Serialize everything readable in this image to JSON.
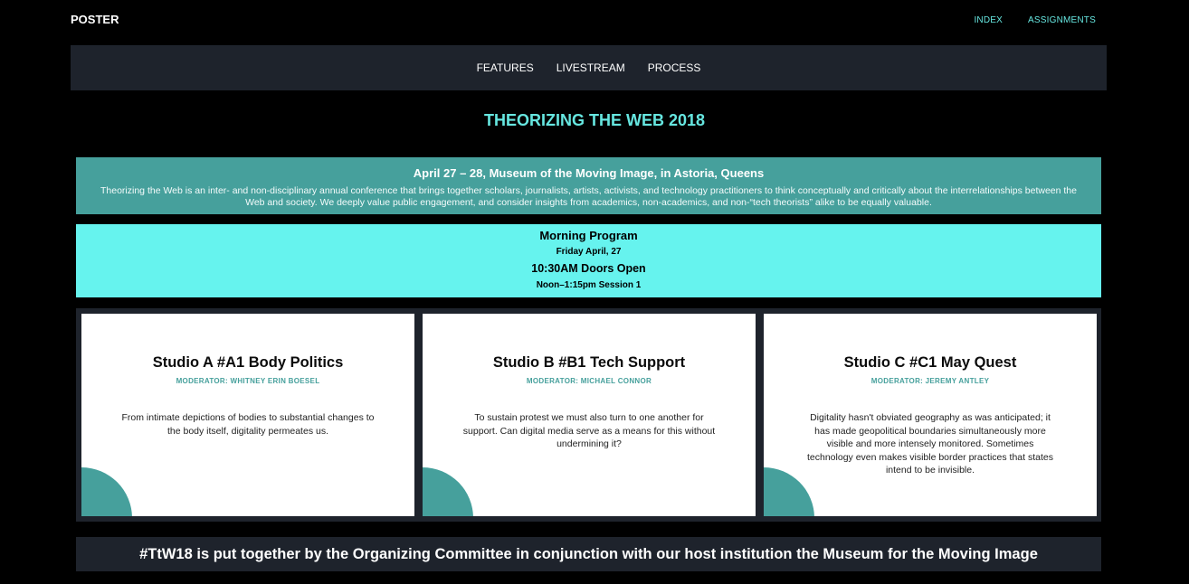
{
  "header": {
    "brand": "POSTER",
    "links": [
      "INDEX",
      "ASSIGNMENTS"
    ],
    "link_color": "#66e6e0"
  },
  "subnav": {
    "items": [
      "FEATURES",
      "LIVESTREAM",
      "PROCESS"
    ]
  },
  "page_title": "THEORIZING THE WEB 2018",
  "info": {
    "headline": "April 27 – 28, Museum of the Moving Image, in Astoria, Queens",
    "description": "Theorizing the Web is an inter- and non-disciplinary annual conference that brings together scholars, journalists, artists, activists, and technology practitioners to think conceptually and critically about the interrelationships between the Web and society. We deeply value public engagement, and consider insights from academics, non-academics, and non-“tech theorists” alike to be equally valuable."
  },
  "program": {
    "title": "Morning Program",
    "date": "Friday April, 27",
    "doors": "10:30AM Doors Open",
    "session": "Noon–1:15pm Session 1"
  },
  "cards": [
    {
      "title": "Studio A #A1 Body Politics",
      "moderator": "MODERATOR: WHITNEY ERIN BOESEL",
      "description": "From intimate depictions of bodies to substantial changes to the body itself, digitality permeates us."
    },
    {
      "title": "Studio B #B1 Tech Support",
      "moderator": "MODERATOR: MICHAEL CONNOR",
      "description": "To sustain protest we must also turn to one another for support. Can digital media serve as a means for this without undermining it?"
    },
    {
      "title": "Studio C #C1 May Quest",
      "moderator": "MODERATOR: JEREMY ANTLEY",
      "description": "Digitality hasn't obviated geography as was anticipated; it has made geopolitical boundaries simultaneously more visible and more intensely monitored. Sometimes technology even makes visible border practices that states intend to be invisible."
    }
  ],
  "footer": "#TtW18 is put together by the Organizing Committee in conjunction with our host institution the Museum for the Moving Image",
  "colors": {
    "accent": "#66e6e0",
    "teal": "#46a09c",
    "panel": "#1e232c"
  }
}
